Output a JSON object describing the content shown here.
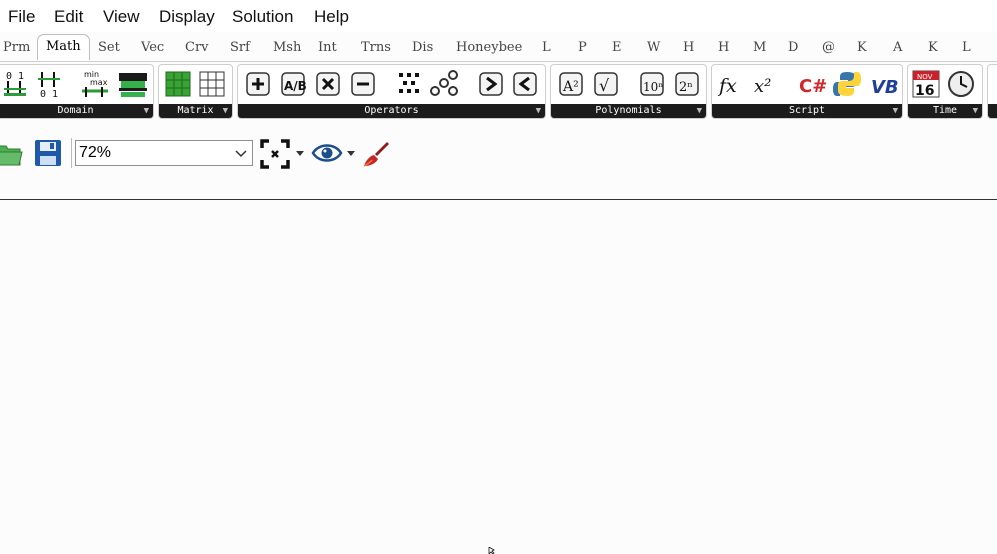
{
  "menu": [
    "File",
    "Edit",
    "View",
    "Display",
    "Solution",
    "Help"
  ],
  "tabs": [
    "Prm",
    "Math",
    "Set",
    "Vec",
    "Crv",
    "Srf",
    "Msh",
    "Int",
    "Trns",
    "Dis",
    "Honeybee",
    "L",
    "P",
    "E",
    "W",
    "H",
    "H",
    "M",
    "D",
    "@",
    "K",
    "A",
    "K",
    "L"
  ],
  "active_tab": "Math",
  "panels": {
    "domain": "Domain",
    "matrix": "Matrix",
    "operators": "Operators",
    "polynomials": "Polynomials",
    "script": "Script",
    "time": "Time"
  },
  "icon_text": {
    "bounds_top": "0 1",
    "construct_bottom": "0 1",
    "remap_min": "min",
    "remap_max": "max",
    "divide": "A/B",
    "power": "A²",
    "sqrt": "√",
    "power10": "10ⁿ",
    "power2": "2ⁿ",
    "expression": "fx",
    "eval": "x²",
    "csharp": "C#",
    "vb": "VB",
    "calendar_month": "NOV",
    "calendar_day": "16"
  },
  "toolbar": {
    "zoom_value": "72%"
  },
  "colors": {
    "canvas": "#fcfcfc",
    "label_bar": "#1c1c1c",
    "matrix_green": "#3aa336",
    "csharp_red": "#d3262b",
    "calendar_red": "#c9222a"
  }
}
